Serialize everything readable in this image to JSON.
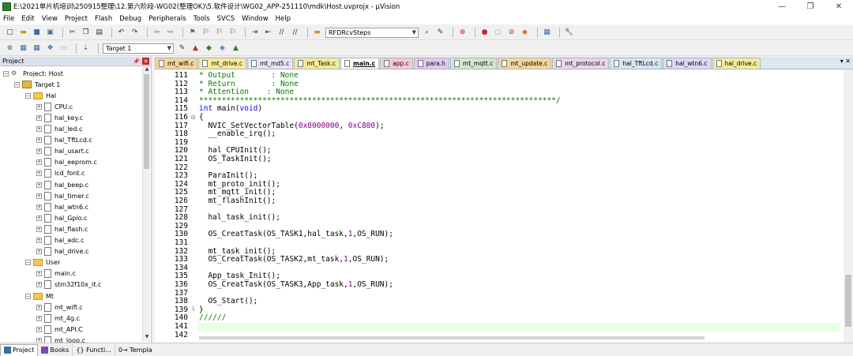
{
  "window": {
    "title": "E:\\2021单片机培训\\250915整理\\12.第六阶段-WG02(整理OK)\\5.软件设计\\WG02_APP-251110\\mdk\\Host.uvprojx - µVision",
    "minimize": "—",
    "maximize": "❐",
    "close": "✕"
  },
  "menu": [
    "File",
    "Edit",
    "View",
    "Project",
    "Flash",
    "Debug",
    "Peripherals",
    "Tools",
    "SVCS",
    "Window",
    "Help"
  ],
  "toolbar": {
    "find_combo": "RFDRcvSteps",
    "target_combo": "Target 1"
  },
  "project_panel": {
    "title": "Project",
    "tree": [
      {
        "label": "Project: Host",
        "level": 0,
        "kind": "project",
        "exp": "−"
      },
      {
        "label": "Target 1",
        "level": 1,
        "kind": "target",
        "exp": "−"
      },
      {
        "label": "Hal",
        "level": 2,
        "kind": "folder",
        "exp": "−"
      },
      {
        "label": "CPU.c",
        "level": 3,
        "kind": "file",
        "exp": "+"
      },
      {
        "label": "hal_key.c",
        "level": 3,
        "kind": "file",
        "exp": "+"
      },
      {
        "label": "hal_led.c",
        "level": 3,
        "kind": "file",
        "exp": "+"
      },
      {
        "label": "hal_TftLcd.c",
        "level": 3,
        "kind": "file",
        "exp": "+"
      },
      {
        "label": "hal_usart.c",
        "level": 3,
        "kind": "file",
        "exp": "+"
      },
      {
        "label": "hal_eeprom.c",
        "level": 3,
        "kind": "file",
        "exp": "+"
      },
      {
        "label": "lcd_font.c",
        "level": 3,
        "kind": "file",
        "exp": "+"
      },
      {
        "label": "hal_beep.c",
        "level": 3,
        "kind": "file",
        "exp": "+"
      },
      {
        "label": "hal_timer.c",
        "level": 3,
        "kind": "file",
        "exp": "+"
      },
      {
        "label": "hal_wtn6.c",
        "level": 3,
        "kind": "file",
        "exp": "+"
      },
      {
        "label": "hal_Gpio.c",
        "level": 3,
        "kind": "file",
        "exp": "+"
      },
      {
        "label": "hal_flash.c",
        "level": 3,
        "kind": "file",
        "exp": "+"
      },
      {
        "label": "hal_adc.c",
        "level": 3,
        "kind": "file",
        "exp": "+"
      },
      {
        "label": "hal_drive.c",
        "level": 3,
        "kind": "file",
        "exp": "+"
      },
      {
        "label": "User",
        "level": 2,
        "kind": "folder",
        "exp": "−"
      },
      {
        "label": "main.c",
        "level": 3,
        "kind": "file",
        "exp": "+"
      },
      {
        "label": "stm32f10x_it.c",
        "level": 3,
        "kind": "file",
        "exp": "+"
      },
      {
        "label": "Mt",
        "level": 2,
        "kind": "folder",
        "exp": "−"
      },
      {
        "label": "mt_wifi.c",
        "level": 3,
        "kind": "file",
        "exp": "+"
      },
      {
        "label": "mt_4g.c",
        "level": 3,
        "kind": "file",
        "exp": "+"
      },
      {
        "label": "mt_API.C",
        "level": 3,
        "kind": "file",
        "exp": "+"
      },
      {
        "label": "mt_loop.c",
        "level": 3,
        "kind": "file",
        "exp": "+"
      }
    ],
    "bottom_tabs": [
      {
        "label": "Project",
        "active": true
      },
      {
        "label": "Books",
        "active": false
      },
      {
        "label": "{} Functi...",
        "active": false
      },
      {
        "label": "0→ Templa...",
        "active": false
      }
    ]
  },
  "editor_tabs": [
    {
      "label": "mt_wifi.c",
      "color": "#f6d59a"
    },
    {
      "label": "mt_drive.c",
      "color": "#f6ea9a"
    },
    {
      "label": "mt_md5.c",
      "color": "#e8e4f6"
    },
    {
      "label": "mt_Task.c",
      "color": "#f6ea9a"
    },
    {
      "label": "main.c",
      "color": "#ffffff",
      "active": true
    },
    {
      "label": "app.c",
      "color": "#f6c8d8"
    },
    {
      "label": "para.h",
      "color": "#e2c8f0"
    },
    {
      "label": "mt_mqtt.c",
      "color": "#cfe8cf"
    },
    {
      "label": "mt_update.c",
      "color": "#f6d59a"
    },
    {
      "label": "mt_protocol.c",
      "color": "#ecd4ec"
    },
    {
      "label": "hal_TftLcd.c",
      "color": "#d4e6f6"
    },
    {
      "label": "hal_wtn6.c",
      "color": "#dcd8f4"
    },
    {
      "label": "hal_drive.c",
      "color": "#f6ea9a"
    }
  ],
  "editor": {
    "lines": [
      {
        "n": "111",
        "fold": "",
        "parts": [
          {
            "t": "* Output        : None",
            "c": "cm"
          }
        ]
      },
      {
        "n": "112",
        "fold": "",
        "parts": [
          {
            "t": "* Return        : None",
            "c": "cm"
          }
        ]
      },
      {
        "n": "113",
        "fold": "",
        "parts": [
          {
            "t": "* Attention    : None",
            "c": "cm"
          }
        ]
      },
      {
        "n": "114",
        "fold": "",
        "parts": [
          {
            "t": "*******************************************************************************/",
            "c": "cm"
          }
        ]
      },
      {
        "n": "115",
        "fold": "",
        "parts": [
          {
            "t": "int",
            "c": "kw"
          },
          {
            "t": " main(",
            "c": ""
          },
          {
            "t": "void",
            "c": "kw"
          },
          {
            "t": ")",
            "c": ""
          }
        ]
      },
      {
        "n": "116",
        "fold": "⊟",
        "parts": [
          {
            "t": "{",
            "c": ""
          }
        ]
      },
      {
        "n": "117",
        "fold": "",
        "parts": [
          {
            "t": "  NVIC_SetVectorTable(",
            "c": ""
          },
          {
            "t": "0x8000000",
            "c": "num"
          },
          {
            "t": ", ",
            "c": ""
          },
          {
            "t": "0xC800",
            "c": "num"
          },
          {
            "t": ");",
            "c": ""
          }
        ]
      },
      {
        "n": "118",
        "fold": "",
        "parts": [
          {
            "t": "  __enable_irq();",
            "c": ""
          }
        ]
      },
      {
        "n": "119",
        "fold": "",
        "parts": [
          {
            "t": "",
            "c": ""
          }
        ]
      },
      {
        "n": "120",
        "fold": "",
        "parts": [
          {
            "t": "  hal_CPUInit();",
            "c": ""
          }
        ]
      },
      {
        "n": "121",
        "fold": "",
        "parts": [
          {
            "t": "  OS_TaskInit();",
            "c": ""
          }
        ]
      },
      {
        "n": "122",
        "fold": "",
        "parts": [
          {
            "t": "",
            "c": ""
          }
        ]
      },
      {
        "n": "123",
        "fold": "",
        "parts": [
          {
            "t": "  ParaInit();",
            "c": ""
          }
        ]
      },
      {
        "n": "124",
        "fold": "",
        "parts": [
          {
            "t": "  mt_proto_init();",
            "c": ""
          }
        ]
      },
      {
        "n": "125",
        "fold": "",
        "parts": [
          {
            "t": "  mt_mqtt_init();",
            "c": ""
          }
        ]
      },
      {
        "n": "126",
        "fold": "",
        "parts": [
          {
            "t": "  mt_flashInit();",
            "c": ""
          }
        ]
      },
      {
        "n": "127",
        "fold": "",
        "parts": [
          {
            "t": "",
            "c": ""
          }
        ]
      },
      {
        "n": "128",
        "fold": "",
        "parts": [
          {
            "t": "  hal_task_init();",
            "c": ""
          }
        ]
      },
      {
        "n": "129",
        "fold": "",
        "parts": [
          {
            "t": "",
            "c": ""
          }
        ]
      },
      {
        "n": "130",
        "fold": "",
        "parts": [
          {
            "t": "  OS_CreatTask(OS_TASK1,hal_task,",
            "c": ""
          },
          {
            "t": "1",
            "c": "num"
          },
          {
            "t": ",OS_RUN);",
            "c": ""
          }
        ]
      },
      {
        "n": "131",
        "fold": "",
        "parts": [
          {
            "t": "",
            "c": ""
          }
        ]
      },
      {
        "n": "132",
        "fold": "",
        "parts": [
          {
            "t": "  mt_task_init();",
            "c": ""
          }
        ]
      },
      {
        "n": "133",
        "fold": "",
        "parts": [
          {
            "t": "  OS_CreatTask(OS_TASK2,mt_task,",
            "c": ""
          },
          {
            "t": "1",
            "c": "num"
          },
          {
            "t": ",OS_RUN);",
            "c": ""
          }
        ]
      },
      {
        "n": "134",
        "fold": "",
        "parts": [
          {
            "t": "",
            "c": ""
          }
        ]
      },
      {
        "n": "135",
        "fold": "",
        "parts": [
          {
            "t": "  App_task_Init();",
            "c": ""
          }
        ]
      },
      {
        "n": "136",
        "fold": "",
        "parts": [
          {
            "t": "  OS_CreatTask(OS_TASK3,App_task,",
            "c": ""
          },
          {
            "t": "1",
            "c": "num"
          },
          {
            "t": ",OS_RUN);",
            "c": ""
          }
        ]
      },
      {
        "n": "137",
        "fold": "",
        "parts": [
          {
            "t": "",
            "c": ""
          }
        ]
      },
      {
        "n": "138",
        "fold": "",
        "parts": [
          {
            "t": "  OS_Start();",
            "c": ""
          }
        ]
      },
      {
        "n": "139",
        "fold": "└",
        "parts": [
          {
            "t": "}",
            "c": ""
          }
        ]
      },
      {
        "n": "140",
        "fold": "",
        "parts": [
          {
            "t": "//////",
            "c": "cm"
          }
        ]
      },
      {
        "n": "141",
        "fold": "",
        "parts": [
          {
            "t": "",
            "c": ""
          }
        ]
      },
      {
        "n": "142",
        "fold": "",
        "parts": [
          {
            "t": "",
            "c": ""
          }
        ]
      }
    ],
    "current_line": "141"
  }
}
